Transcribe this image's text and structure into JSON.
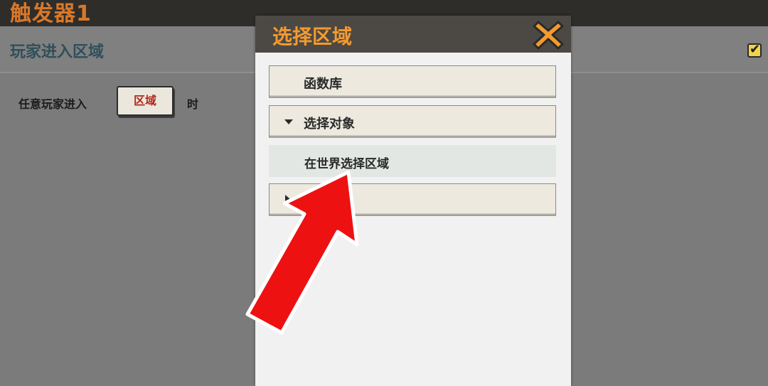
{
  "topbar": {
    "title": "触发器1"
  },
  "editor": {
    "section_title": "玩家进入区域",
    "enabled_check": "✔",
    "condition": {
      "prefix": "任意玩家进入",
      "region_button": "区域",
      "suffix": "时"
    }
  },
  "dialog": {
    "title": "选择区域",
    "close_icon": "close-icon",
    "items": [
      {
        "label": "函数库",
        "expandable": false
      },
      {
        "label": "选择对象",
        "expandable": true,
        "expanded": true
      },
      {
        "label": "在世界选择区域",
        "subitem": true
      },
      {
        "label": "",
        "expandable": true,
        "expanded": false
      }
    ]
  },
  "overlay": {
    "arrow_icon": "red-pointer-arrow-icon"
  },
  "colors": {
    "accent_orange": "#f39a2f",
    "title_orange": "#d9782a",
    "region_red": "#b3271e",
    "check_yellow": "#f0d34a",
    "arrow_red": "#ee1111"
  }
}
